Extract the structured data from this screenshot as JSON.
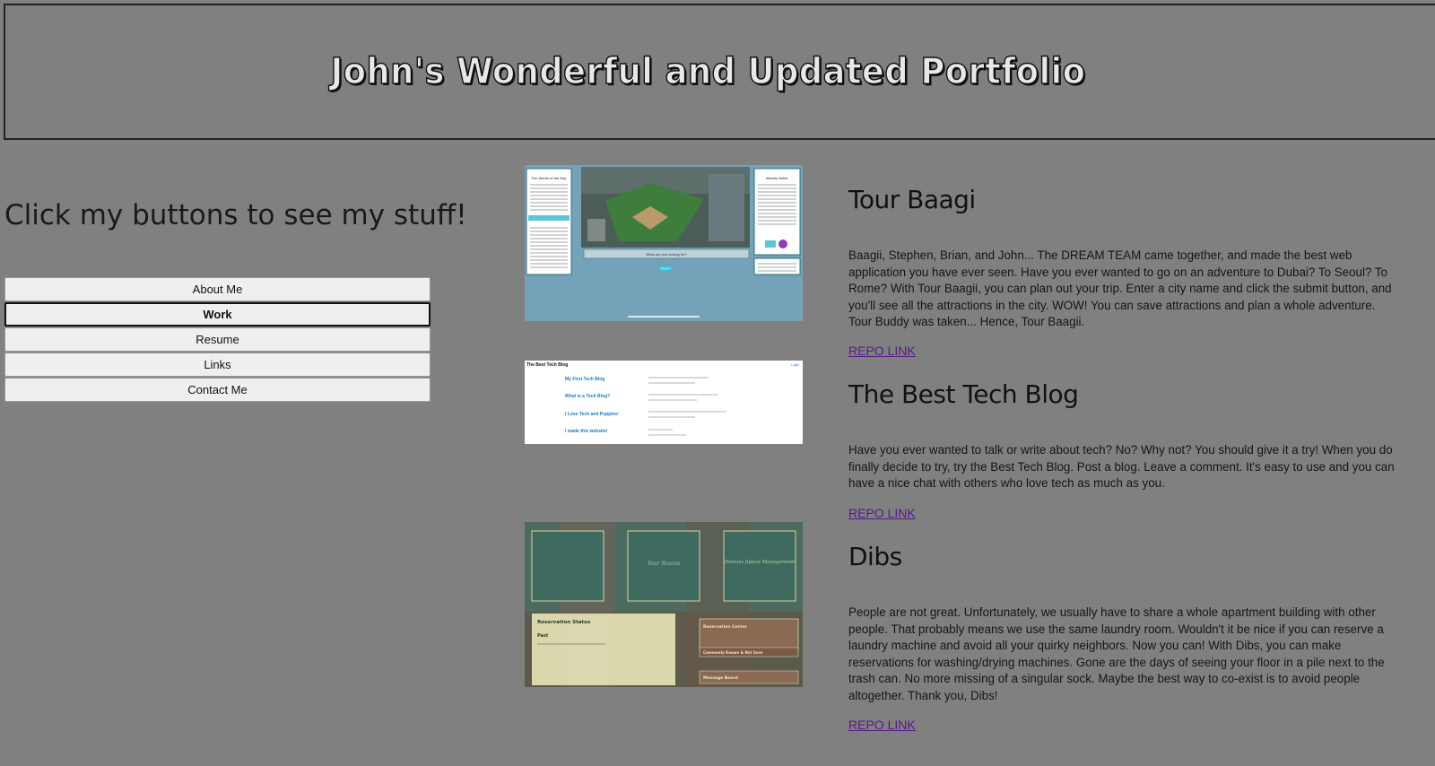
{
  "header": {
    "title": "John's Wonderful and Updated Portfolio"
  },
  "tagline": "Click my buttons to see my stuff!",
  "nav": {
    "items": [
      {
        "label": "About Me"
      },
      {
        "label": "Work"
      },
      {
        "label": "Resume"
      },
      {
        "label": "Links"
      },
      {
        "label": "Contact Me"
      }
    ],
    "active": "Work"
  },
  "projects": [
    {
      "title": "Tour Baagi",
      "description": "Baagii, Stephen, Brian, and John... The DREAM TEAM came together, and made the best web application you have ever seen. Have you ever wanted to go on an adventure to Dubai? To Seoul? To Rome? With Tour Baagii, you can plan out your trip. Enter a city name and click the submit button, and you'll see all the attractions in the city. WOW! You can save attractions and plan a whole adventure. Tour Buddy was taken... Hence, Tour Baagii.",
      "link": "REPO LINK",
      "screenshot": {
        "left_title": "Fun Words of the Day",
        "right_title": "Weekly Notes",
        "search_placeholder": "What are you looking for?",
        "button": "Search"
      }
    },
    {
      "title": "The Best Tech Blog",
      "description": "Have you ever wanted to talk or write about tech? No? Why not? You should give it a try! When you do finally decide to try, try the Best Tech Blog. Post a blog. Leave a comment. It's easy to use and you can have a nice chat with others who love tech as much as you.",
      "link": "REPO LINK",
      "screenshot": {
        "site_title": "The Best Tech Blog",
        "login": "Login",
        "posts": [
          "My First Tech Blog",
          "What is a Tech Blog?",
          "I Love Tech and Puppies!",
          "I made this website!"
        ]
      }
    },
    {
      "title": "Dibs",
      "description": "People are not great. Unfortunately, we usually have to share a whole apartment building with other people. That probably means we use the same laundry room. Wouldn't it be nice if you can reserve a laundry machine and avoid all your quirky neighbors. Now you can! With Dibs, you can make reservations for washing/drying machines. Gone are the days of seeing your floor in a pile next to the trash can. No more missing of a singular sock. Maybe the best way to co-exist is to avoid people altogether. Thank you, Dibs!",
      "link": "REPO LINK",
      "screenshot": {
        "tiles": [
          "",
          "Your Rooms",
          "Discuss Space Management"
        ],
        "panel_left_title": "Reservation Status",
        "panel_left_sub": "Past",
        "panel_right_items": [
          "Reservation Center",
          "Commonly Known & Not Sure",
          "Message Board"
        ]
      }
    }
  ],
  "colors": {
    "background": "#808080",
    "link": "#551a8b",
    "button_bg": "#efefef"
  }
}
